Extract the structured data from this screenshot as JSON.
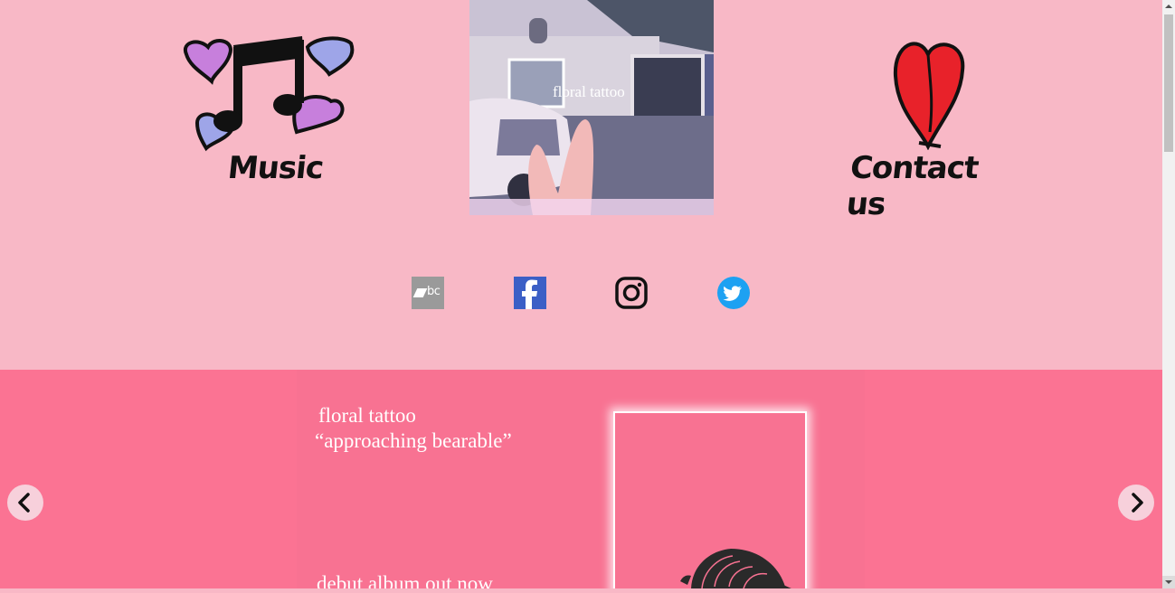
{
  "nav": {
    "music_label": "Music",
    "contact_label": "Contact us"
  },
  "cover": {
    "title": "floral tattoo"
  },
  "social": [
    {
      "name": "bandcamp",
      "text": "bc"
    },
    {
      "name": "facebook"
    },
    {
      "name": "instagram"
    },
    {
      "name": "twitter"
    }
  ],
  "promo": {
    "line1": "floral tattoo",
    "line2": "“approaching bearable”",
    "line3": "debut album out now"
  },
  "colors": {
    "top_background": "#f8b8c6",
    "promo_background": "#fb7393",
    "heart_red": "#e8222a",
    "heart_purple": "#c77fdc",
    "heart_blue": "#9ea5e8",
    "facebook_blue": "#3b5fc6",
    "twitter_blue": "#1da1f2"
  }
}
